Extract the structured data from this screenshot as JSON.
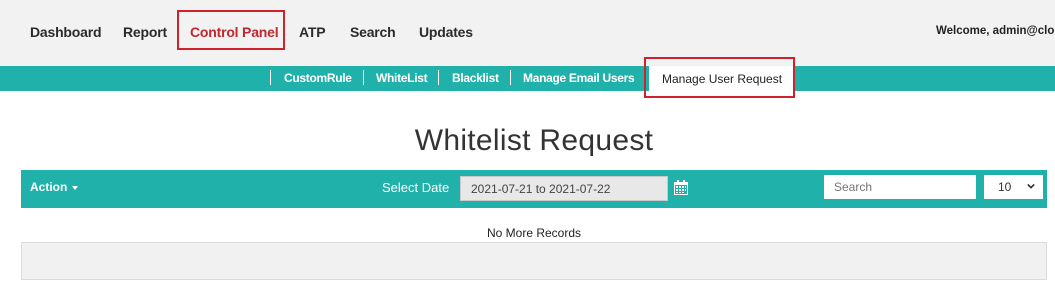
{
  "topnav": {
    "items": [
      "Dashboard",
      "Report",
      "Control Panel",
      "ATP",
      "Search",
      "Updates"
    ],
    "welcome": "Welcome, admin@clou"
  },
  "subnav": {
    "items": [
      "CustomRule",
      "WhiteList",
      "Blacklist",
      "Manage Email Users"
    ],
    "active": "Manage User Request"
  },
  "page": {
    "title": "Whitelist Request"
  },
  "toolbar": {
    "action_label": "Action",
    "select_date_label": "Select Date",
    "date_range": "2021-07-21 to 2021-07-22",
    "search_placeholder": "Search",
    "page_size": "10"
  },
  "table": {
    "empty_message": "No More Records"
  },
  "colors": {
    "accent": "#20b2aa",
    "highlight": "#d0222a",
    "active_nav": "#c1272d"
  }
}
